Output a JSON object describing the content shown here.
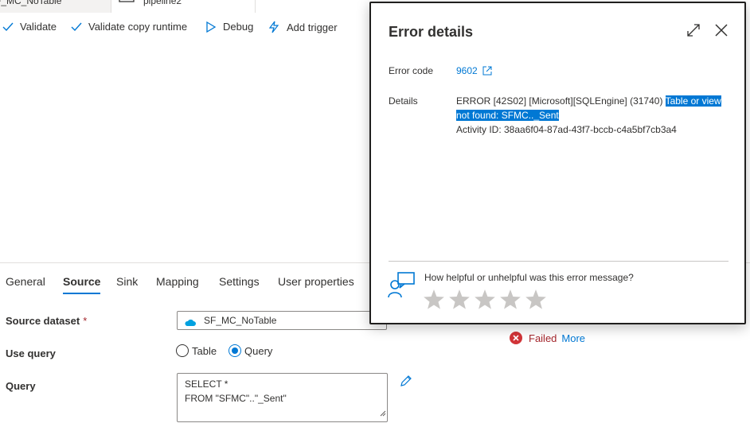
{
  "tabs": [
    {
      "label": "F_MC_NoTable"
    },
    {
      "label": "pipeline2"
    }
  ],
  "toolbar": {
    "validate": "Validate",
    "validate_copy_runtime": "Validate copy runtime",
    "debug": "Debug",
    "add_trigger": "Add trigger"
  },
  "properties": {
    "tabs": [
      "General",
      "Source",
      "Sink",
      "Mapping",
      "Settings",
      "User properties"
    ],
    "active_tab": "Source",
    "source_dataset_label": "Source dataset",
    "required_marker": "*",
    "source_dataset_value": "SF_MC_NoTable",
    "use_query_label": "Use query",
    "option_table": "Table",
    "option_query": "Query",
    "selected_option": "Query",
    "query_label": "Query",
    "query_lines": [
      "SELECT *",
      "FROM \"SFMC\"..\"_Sent\""
    ]
  },
  "status": {
    "text": "Failed",
    "more": "More",
    "color": "#a4262c"
  },
  "error_dialog": {
    "title": "Error details",
    "error_code_label": "Error code",
    "error_code": "9602",
    "details_label": "Details",
    "details_plain": "ERROR [42S02] [Microsoft][SQLEngine] (31740) ",
    "details_highlight": "Table or view not found: SFMC.._Sent",
    "activity_id": "Activity ID: 38aa6f04-87ad-43f7-bccb-c4a5bf7cb3a4",
    "feedback_question": "How helpful or unhelpful was this error message?",
    "star_count": 5
  },
  "colors": {
    "accent": "#0078d4",
    "error": "#d13438",
    "star": "#c8c6c4"
  }
}
